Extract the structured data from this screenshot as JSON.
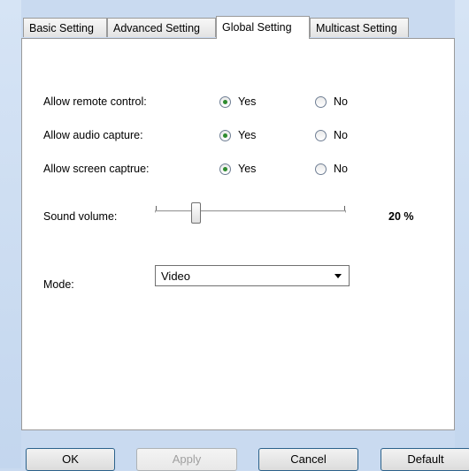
{
  "tabs": [
    {
      "label": "Basic Setting"
    },
    {
      "label": "Advanced Setting"
    },
    {
      "label": "Global Setting"
    },
    {
      "label": "Multicast Setting"
    }
  ],
  "active_tab": "Global Setting",
  "options": [
    {
      "label": "Allow remote control:",
      "yes": "Yes",
      "no": "No",
      "selected": "Yes"
    },
    {
      "label": "Allow audio capture:",
      "yes": "Yes",
      "no": "No",
      "selected": "Yes"
    },
    {
      "label": "Allow screen captrue:",
      "yes": "Yes",
      "no": "No",
      "selected": "Yes"
    }
  ],
  "volume": {
    "label": "Sound volume:",
    "value": 0.2,
    "display": "20 %"
  },
  "mode": {
    "label": "Mode:",
    "value": "Video"
  },
  "buttons": {
    "ok": "OK",
    "apply": "Apply",
    "cancel": "Cancel",
    "default": "Default"
  }
}
